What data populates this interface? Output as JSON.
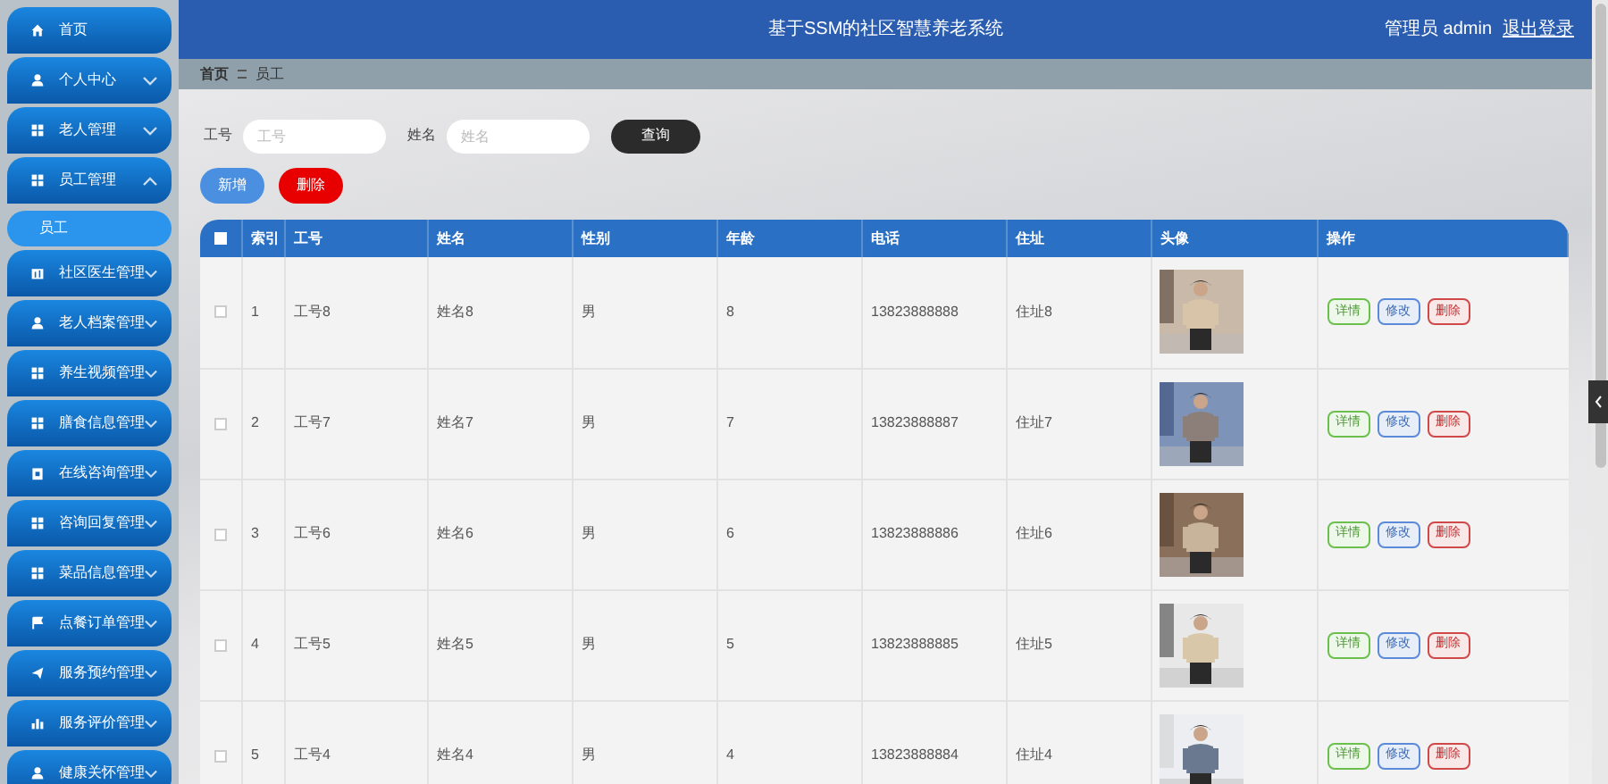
{
  "header": {
    "title": "基于SSM的社区智慧养老系统",
    "user": "管理员 admin",
    "logout": "退出登录"
  },
  "sidebar": {
    "items": [
      {
        "kind": "link",
        "label": "首页"
      },
      {
        "kind": "group",
        "label": "个人中心",
        "expanded": false
      },
      {
        "kind": "group",
        "label": "老人管理",
        "expanded": false
      },
      {
        "kind": "group",
        "label": "员工管理",
        "expanded": true,
        "children": [
          {
            "label": "员工",
            "selected": true
          }
        ]
      },
      {
        "kind": "group",
        "label": "社区医生管理",
        "expanded": false
      },
      {
        "kind": "group",
        "label": "老人档案管理",
        "expanded": false
      },
      {
        "kind": "group",
        "label": "养生视频管理",
        "expanded": false
      },
      {
        "kind": "group",
        "label": "膳食信息管理",
        "expanded": false
      },
      {
        "kind": "group",
        "label": "在线咨询管理",
        "expanded": false
      },
      {
        "kind": "group",
        "label": "咨询回复管理",
        "expanded": false
      },
      {
        "kind": "group",
        "label": "菜品信息管理",
        "expanded": false
      },
      {
        "kind": "group",
        "label": "点餐订单管理",
        "expanded": false
      },
      {
        "kind": "group",
        "label": "服务预约管理",
        "expanded": false
      },
      {
        "kind": "group",
        "label": "服务评价管理",
        "expanded": false
      },
      {
        "kind": "group",
        "label": "健康关怀管理",
        "expanded": false
      }
    ]
  },
  "breadcrumb": [
    "首页",
    "员工"
  ],
  "search": {
    "fields": [
      {
        "label": "工号",
        "placeholder": "工号"
      },
      {
        "label": "姓名",
        "placeholder": "姓名"
      }
    ],
    "button": "查询"
  },
  "actions": [
    {
      "kind": "add",
      "label": "新增"
    },
    {
      "kind": "delete",
      "label": "删除"
    }
  ],
  "table": {
    "select_all_checked": false,
    "columns": [
      "索引",
      "工号",
      "姓名",
      "性别",
      "年龄",
      "电话",
      "住址",
      "头像",
      "操作"
    ],
    "rows": [
      {
        "checked": false,
        "cells": [
          "1",
          "工号8",
          "姓名8",
          "男",
          "8",
          "13823888888",
          "住址8"
        ],
        "buttons": [
          "详情",
          "修改",
          "删除"
        ]
      },
      {
        "checked": false,
        "cells": [
          "2",
          "工号7",
          "姓名7",
          "男",
          "7",
          "13823888887",
          "住址7"
        ],
        "buttons": [
          "详情",
          "修改",
          "删除"
        ]
      },
      {
        "checked": false,
        "cells": [
          "3",
          "工号6",
          "姓名6",
          "男",
          "6",
          "13823888886",
          "住址6"
        ],
        "buttons": [
          "详情",
          "修改",
          "删除"
        ]
      },
      {
        "checked": false,
        "cells": [
          "4",
          "工号5",
          "姓名5",
          "男",
          "5",
          "13823888885",
          "住址5"
        ],
        "buttons": [
          "详情",
          "修改",
          "删除"
        ]
      },
      {
        "checked": false,
        "cells": [
          "5",
          "工号4",
          "姓名4",
          "男",
          "4",
          "13823888884",
          "住址4"
        ],
        "buttons": [
          "详情",
          "修改",
          "删除"
        ]
      }
    ]
  }
}
